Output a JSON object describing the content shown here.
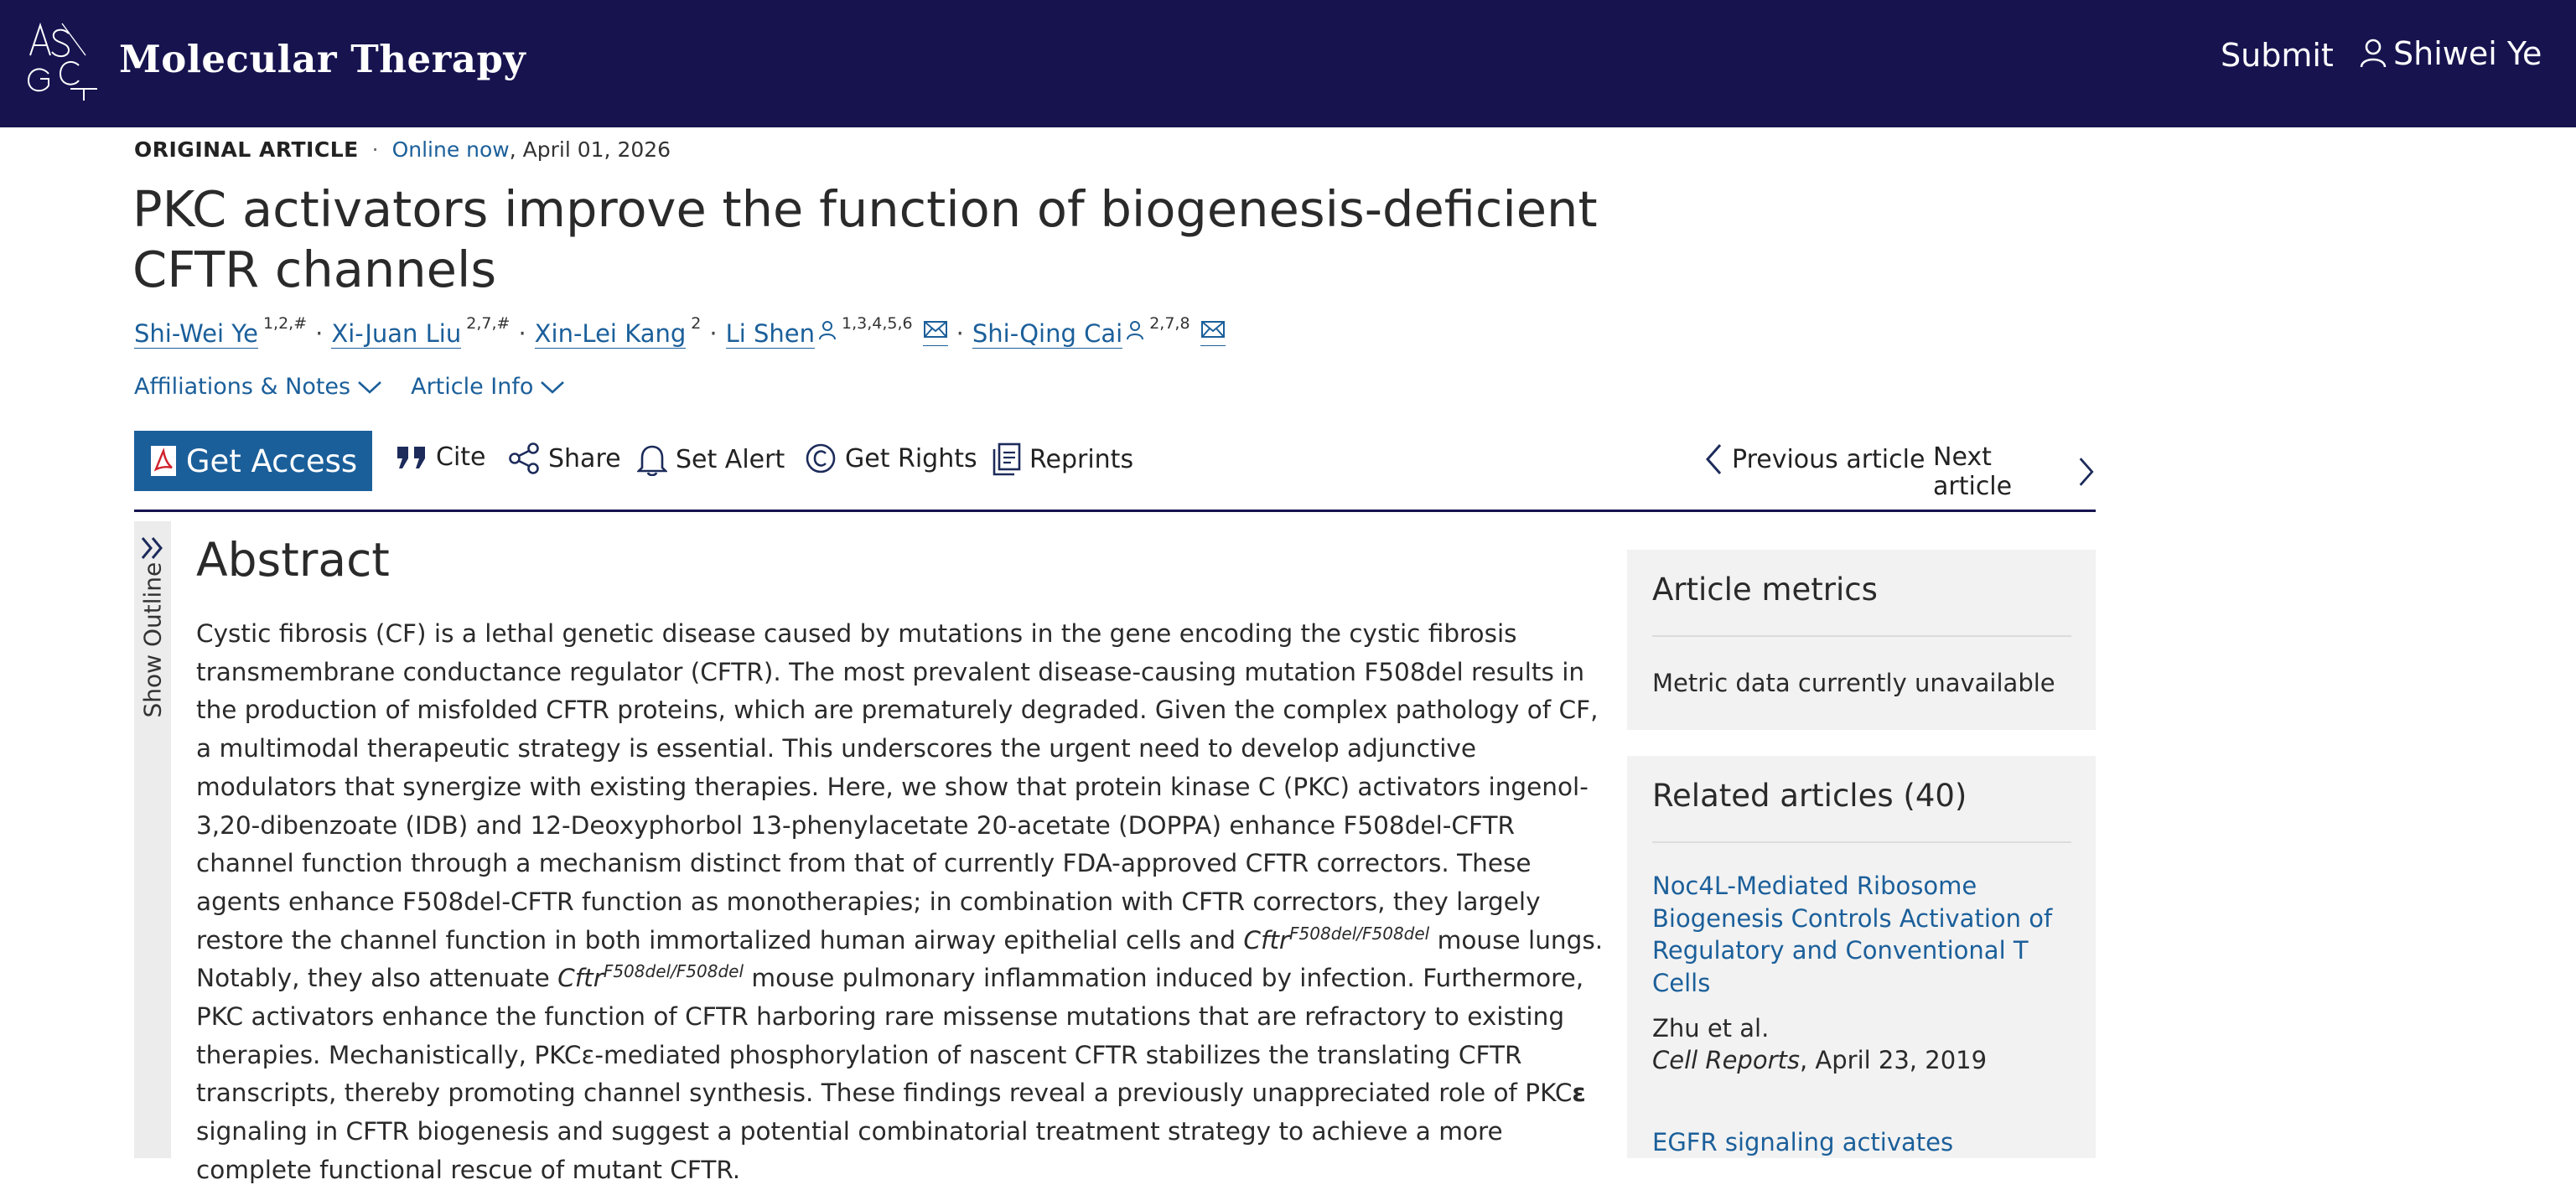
{
  "header": {
    "logo_letters": "ASGCT",
    "journal_name": "Molecular Therapy",
    "submit_label": "Submit",
    "user_name": "Shiwei Ye"
  },
  "article": {
    "type": "ORIGINAL ARTICLE",
    "separator": "·",
    "online_label": "Online now",
    "date": ", April 01, 2026",
    "title": "PKC activators improve the function of biogenesis-deficient CFTR channels",
    "authors": [
      {
        "name": "Shi-Wei Ye",
        "sup": "1,2,#"
      },
      {
        "name": "Xi-Juan Liu",
        "sup": "2,7,#"
      },
      {
        "name": "Xin-Lei Kang",
        "sup": "2"
      },
      {
        "name": "Li Shen",
        "sup": "1,3,4,5,6"
      },
      {
        "name": "Shi-Qing Cai",
        "sup": "2,7,8"
      }
    ],
    "affiliations_label": "Affiliations & Notes",
    "article_info_label": "Article Info"
  },
  "toolbar": {
    "get_access": "Get Access",
    "cite": "Cite",
    "share": "Share",
    "set_alert": "Set Alert",
    "get_rights": "Get Rights",
    "reprints": "Reprints",
    "previous": "Previous article",
    "next": "Next article"
  },
  "outline": {
    "label": "Show Outline"
  },
  "abstract": {
    "heading": "Abstract",
    "p1": "Cystic fibrosis (CF) is a lethal genetic disease caused by mutations in the gene encoding the cystic fibrosis transmembrane conductance regulator (CFTR). The most prevalent disease-causing mutation F508del results in the production of misfolded CFTR proteins, which are prematurely degraded. Given the complex pathology of CF, a multimodal therapeutic strategy is essential. This underscores the urgent need to develop adjunctive modulators that synergize with existing therapies. Here, we show that protein kinase C (PKC) activators ingenol-3,20-dibenzoate (IDB) and 12-Deoxyphorbol 13-phenylacetate 20-acetate (DOPPA) enhance F508del-CFTR channel function through a mechanism distinct from that of currently FDA-approved CFTR correctors. These agents enhance F508del-CFTR function as monotherapies; in combination with CFTR correctors, they largely restore the channel function in both immortalized human airway epithelial cells and ",
    "gene": "Cftr",
    "genotype": "F508del/F508del",
    "p2": " mouse lungs. Notably, they also attenuate ",
    "p3": " mouse pulmonary inflammation induced by infection. Furthermore, PKC activators enhance the function of CFTR harboring rare missense mutations that are refractory to existing therapies. Mechanistically, PKCε-mediated phosphorylation of nascent CFTR stabilizes the translating CFTR transcripts, thereby promoting channel synthesis. These findings reveal a previously unappreciated role of PKC",
    "epsilon": "ε",
    "p4": " signaling in CFTR biogenesis and suggest a potential combinatorial treatment strategy to achieve a more complete functional rescue of mutant CFTR."
  },
  "sidebar": {
    "metrics_title": "Article metrics",
    "metrics_text": "Metric data currently unavailable",
    "related_title": "Related articles (40)",
    "related": [
      {
        "title": "Noc4L-Mediated Ribosome Biogenesis Controls Activation of Regulatory and Conventional T Cells",
        "authors": "Zhu et al.",
        "journal": "Cell Reports",
        "date": ", April 23, 2019"
      },
      {
        "title": "EGFR signaling activates intestinal"
      }
    ]
  },
  "colors": {
    "header_bg": "#16134f",
    "link": "#1b5f9a",
    "access_button": "#1b5f9a",
    "panel_bg": "#f2f2f2"
  }
}
